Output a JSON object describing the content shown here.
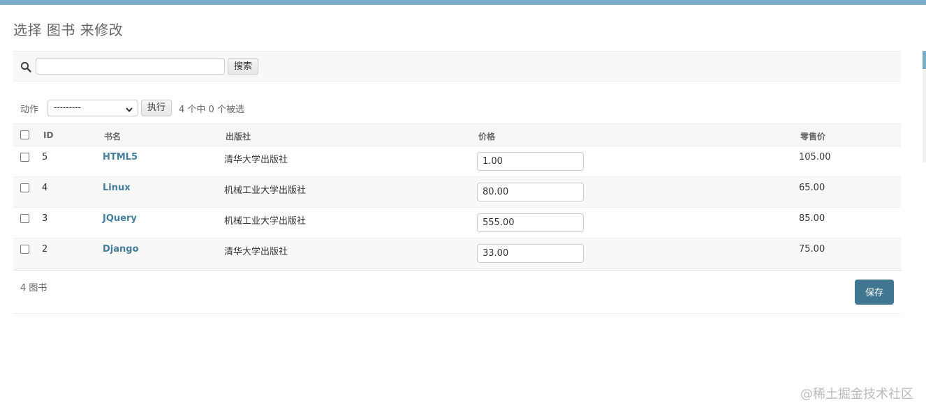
{
  "page": {
    "title": "选择 图书 来修改"
  },
  "search": {
    "placeholder": "",
    "value": "",
    "button_label": "搜索",
    "icon": "search-icon"
  },
  "actions": {
    "label": "动作",
    "selected_option": "---------",
    "run_label": "执行",
    "selection_count_text": "4 个中 0 个被选"
  },
  "table": {
    "headers": {
      "id": "ID",
      "name": "书名",
      "publisher": "出版社",
      "price": "价格",
      "retail_price": "零售价"
    },
    "rows": [
      {
        "id": "5",
        "name": "HTML5",
        "publisher": "清华大学出版社",
        "price": "1.00",
        "retail_price": "105.00"
      },
      {
        "id": "4",
        "name": "Linux",
        "publisher": "机械工业大学出版社",
        "price": "80.00",
        "retail_price": "65.00"
      },
      {
        "id": "3",
        "name": "JQuery",
        "publisher": "机械工业大学出版社",
        "price": "555.00",
        "retail_price": "85.00"
      },
      {
        "id": "2",
        "name": "Django",
        "publisher": "清华大学出版社",
        "price": "33.00",
        "retail_price": "75.00"
      }
    ]
  },
  "footer": {
    "count_text": "4 图书",
    "save_label": "保存"
  },
  "watermark": "@稀土掘金技术社区",
  "colors": {
    "topbar": "#79aec8",
    "link": "#447e9b",
    "save_button": "#417690"
  }
}
